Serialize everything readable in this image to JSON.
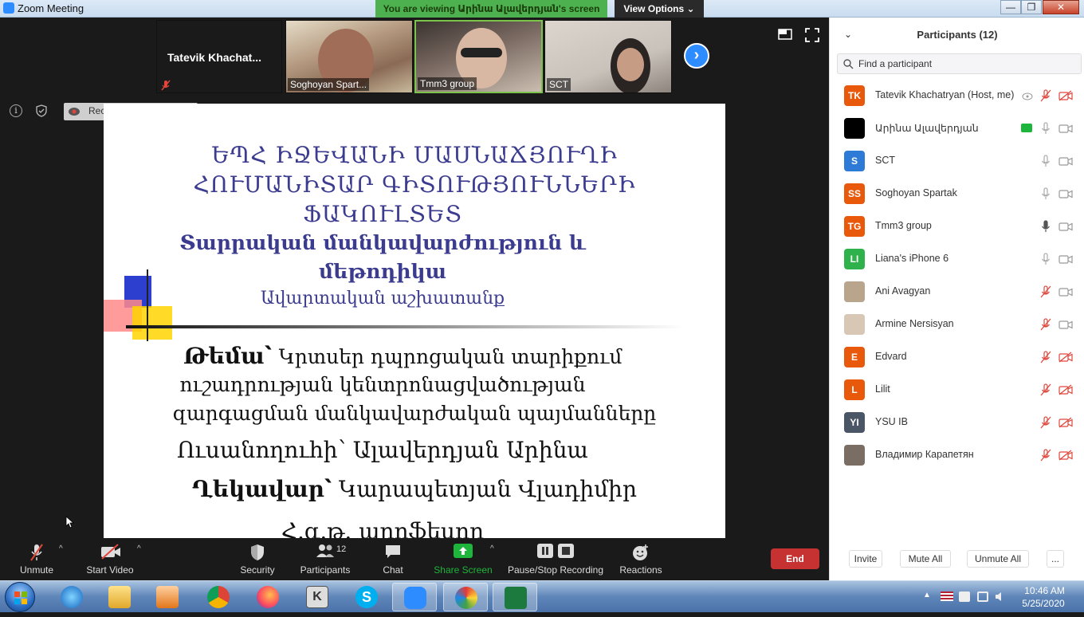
{
  "window": {
    "title": "Zoom Meeting",
    "viewing_banner": "You are viewing Արինա Ալավերդյան's screen",
    "view_options": "View Options",
    "minimize": "—",
    "maximize": "❐",
    "close": "✕"
  },
  "video_strip": {
    "host_name": "Tatevik  Khachat...",
    "tiles": [
      {
        "label": "Soghoyan Spart..."
      },
      {
        "label": "Tmm3 group"
      },
      {
        "label": "SCT"
      }
    ],
    "next_glyph": "›"
  },
  "info_bar": {
    "info_glyph": "i",
    "recording_text": "Recording..."
  },
  "slide": {
    "line1": "ԵՊՀ ԻՋԵՎԱՆԻ ՄԱՍՆԱՃՅՈՒՂԻ",
    "line2": "ՀՈՒՄԱՆԻՏԱՐ ԳԻՏՈՒԹՅՈՒՆՆԵՐԻ",
    "line3": "ՖԱԿՈՒԼՏԵՏ",
    "line4": "Տարրական մանկավարժություն և",
    "line5": "մեթոդիկա",
    "line6": "Ավարտական աշխատանք",
    "topic_label": "Թեմա՝",
    "topic_line1": "Կրտսեր դպրոցական տարիքում",
    "topic_line2": "ուշադրության կենտրոնացվածության",
    "topic_line3": "զարգացման մանկավարժական պայմանները",
    "student_label": "Ուսանողուհի՝",
    "student_name": "Ալավերդյան Արինա",
    "advisor_label": "Ղեկավար՝",
    "advisor_name": "Կարապետյան Վլադիմիր",
    "degree": "Հ.գ.թ. պրոֆեսոր"
  },
  "participants": {
    "title": "Participants (12)",
    "collapse_glyph": "⌄",
    "search_placeholder": "Find a participant",
    "list": [
      {
        "initials": "TK",
        "name": "Tatevik Khachatryan (Host, me)",
        "color": "#e8590c"
      },
      {
        "initials": "",
        "name": "Արինա Ալավերդյան",
        "color": "#000000"
      },
      {
        "initials": "S",
        "name": "SCT",
        "color": "#2d7bd6"
      },
      {
        "initials": "SS",
        "name": "Soghoyan Spartak",
        "color": "#e8590c"
      },
      {
        "initials": "TG",
        "name": "Tmm3 group",
        "color": "#e8590c"
      },
      {
        "initials": "LI",
        "name": "Liana's iPhone 6",
        "color": "#2fb24c"
      },
      {
        "initials": "",
        "name": "Ani Avagyan",
        "color": "#b9a48c"
      },
      {
        "initials": "",
        "name": "Armine Nersisyan",
        "color": "#d9c7b5"
      },
      {
        "initials": "E",
        "name": "Edvard",
        "color": "#e8590c"
      },
      {
        "initials": "L",
        "name": "Lilit",
        "color": "#e8590c"
      },
      {
        "initials": "YI",
        "name": "YSU IB",
        "color": "#4a5566"
      },
      {
        "initials": "",
        "name": "Владимир Карапетян",
        "color": "#7a6d63"
      }
    ],
    "footer": {
      "invite": "Invite",
      "mute_all": "Mute All",
      "unmute_all": "Unmute All",
      "more": "..."
    }
  },
  "toolbar": {
    "unmute": "Unmute",
    "start_video": "Start Video",
    "security": "Security",
    "participants": "Participants",
    "participants_count": "12",
    "chat": "Chat",
    "share_screen": "Share Screen",
    "pause_stop": "Pause/Stop Recording",
    "reactions": "Reactions",
    "end": "End",
    "caret": "^"
  },
  "taskbar": {
    "time": "10:46 AM",
    "date": "5/25/2020",
    "kaspersky_glyph": "K",
    "skype_glyph": "S"
  },
  "colors": {
    "zoom_blue": "#2d8cff",
    "end_red": "#c63131",
    "share_green": "#1db53b",
    "banner_green": "#4db14f",
    "slide_blue": "#3b3b8f",
    "muted_red": "#e0463c"
  }
}
